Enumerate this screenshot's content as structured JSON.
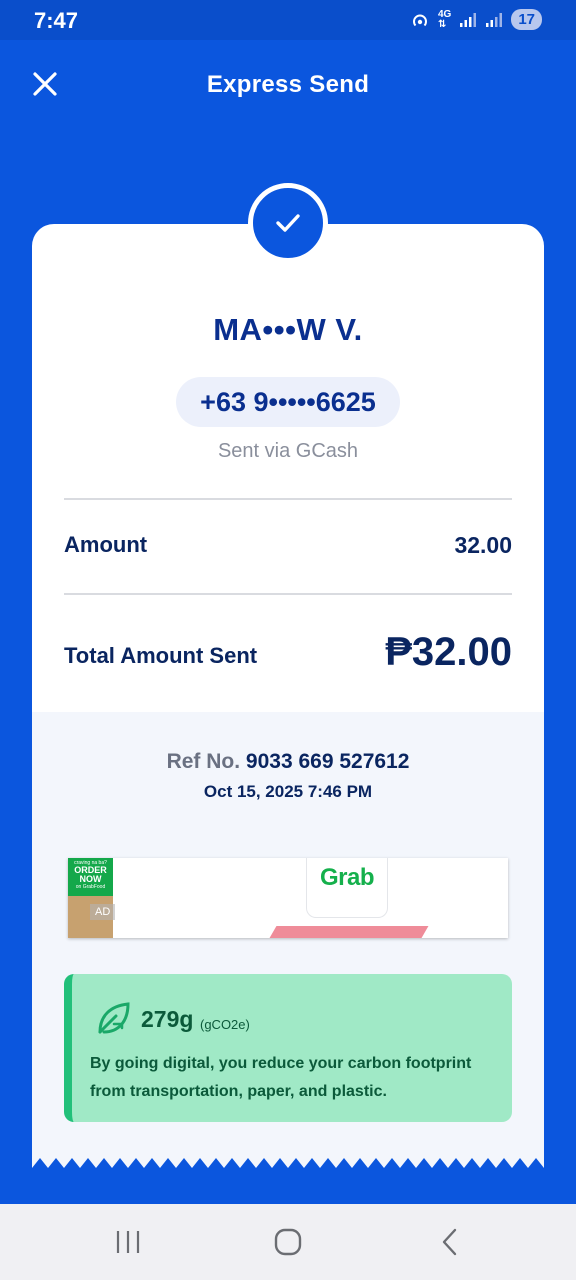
{
  "status": {
    "time": "7:47",
    "network": "4G",
    "battery": "17"
  },
  "header": {
    "title": "Express Send"
  },
  "recipient": {
    "name": "MA•••W V.",
    "phone": "+63 9•••••6625",
    "sent_via": "Sent via GCash"
  },
  "amount": {
    "label": "Amount",
    "value": "32.00"
  },
  "total": {
    "label": "Total Amount Sent",
    "value": "₱32.00"
  },
  "reference": {
    "label": "Ref No.",
    "number": "9033 669 527612",
    "datetime": "Oct 15, 2025 7:46 PM"
  },
  "ad": {
    "tag": "AD",
    "brand": "Grab",
    "promo_line1": "craving na ba?",
    "promo_line2": "ORDER NOW",
    "promo_line3": "on GrabFood"
  },
  "eco": {
    "amount": "279g",
    "unit": "(gCO2e)",
    "message": "By going digital, you reduce your carbon footprint from transportation, paper, and plastic."
  },
  "colors": {
    "primary": "#0b56de",
    "heading": "#0a2560",
    "eco_bg": "#a0e9c6",
    "eco_accent": "#22c07a"
  },
  "icons": {
    "close": "close-icon",
    "check": "check-icon",
    "leaf": "leaf-icon"
  }
}
